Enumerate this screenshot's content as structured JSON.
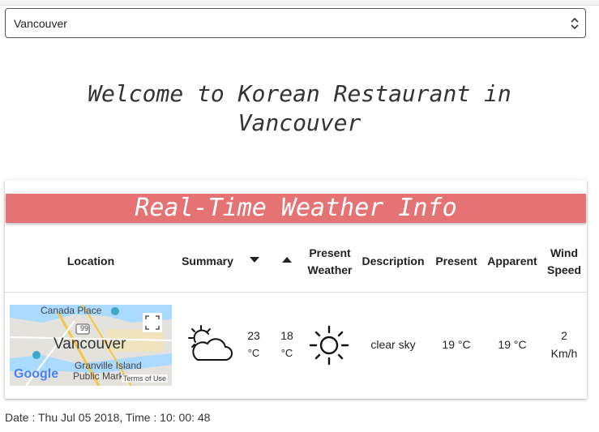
{
  "city_select": {
    "value": "Vancouver",
    "options": [
      "Vancouver"
    ]
  },
  "welcome": {
    "line1": "Welcome to Korean Restaurant in",
    "line2": "Vancouver"
  },
  "weather": {
    "title": "Real-Time Weather Info",
    "headers": {
      "location": "Location",
      "summary": "Summary",
      "present_weather_line1": "Present",
      "present_weather_line2": "Weather",
      "description": "Description",
      "present": "Present",
      "apparent": "Apparent",
      "wind_line1": "Wind",
      "wind_line2": "Speed"
    },
    "row": {
      "high": "23",
      "high_unit": "°C",
      "low": "18",
      "low_unit": "°C",
      "description": "clear sky",
      "present_temp": "19 °C",
      "apparent_temp": "19 °C",
      "wind_value": "2",
      "wind_unit": "Km/h"
    },
    "map": {
      "place_main": "Vancouver",
      "place_canada": "Canada Place",
      "place_granville": "Granville Island",
      "place_public": "Public Mark",
      "highway": "99",
      "logo": "Google",
      "terms": "Terms of Use"
    },
    "icons": {
      "summary": "partly-cloudy-icon",
      "present": "sun-icon"
    }
  },
  "footer": {
    "date_text": "Date : Thu Jul 05 2018, Time : 10: 00: 48"
  },
  "colors": {
    "banner": "#e57373",
    "page_bg": "#ffffff"
  }
}
